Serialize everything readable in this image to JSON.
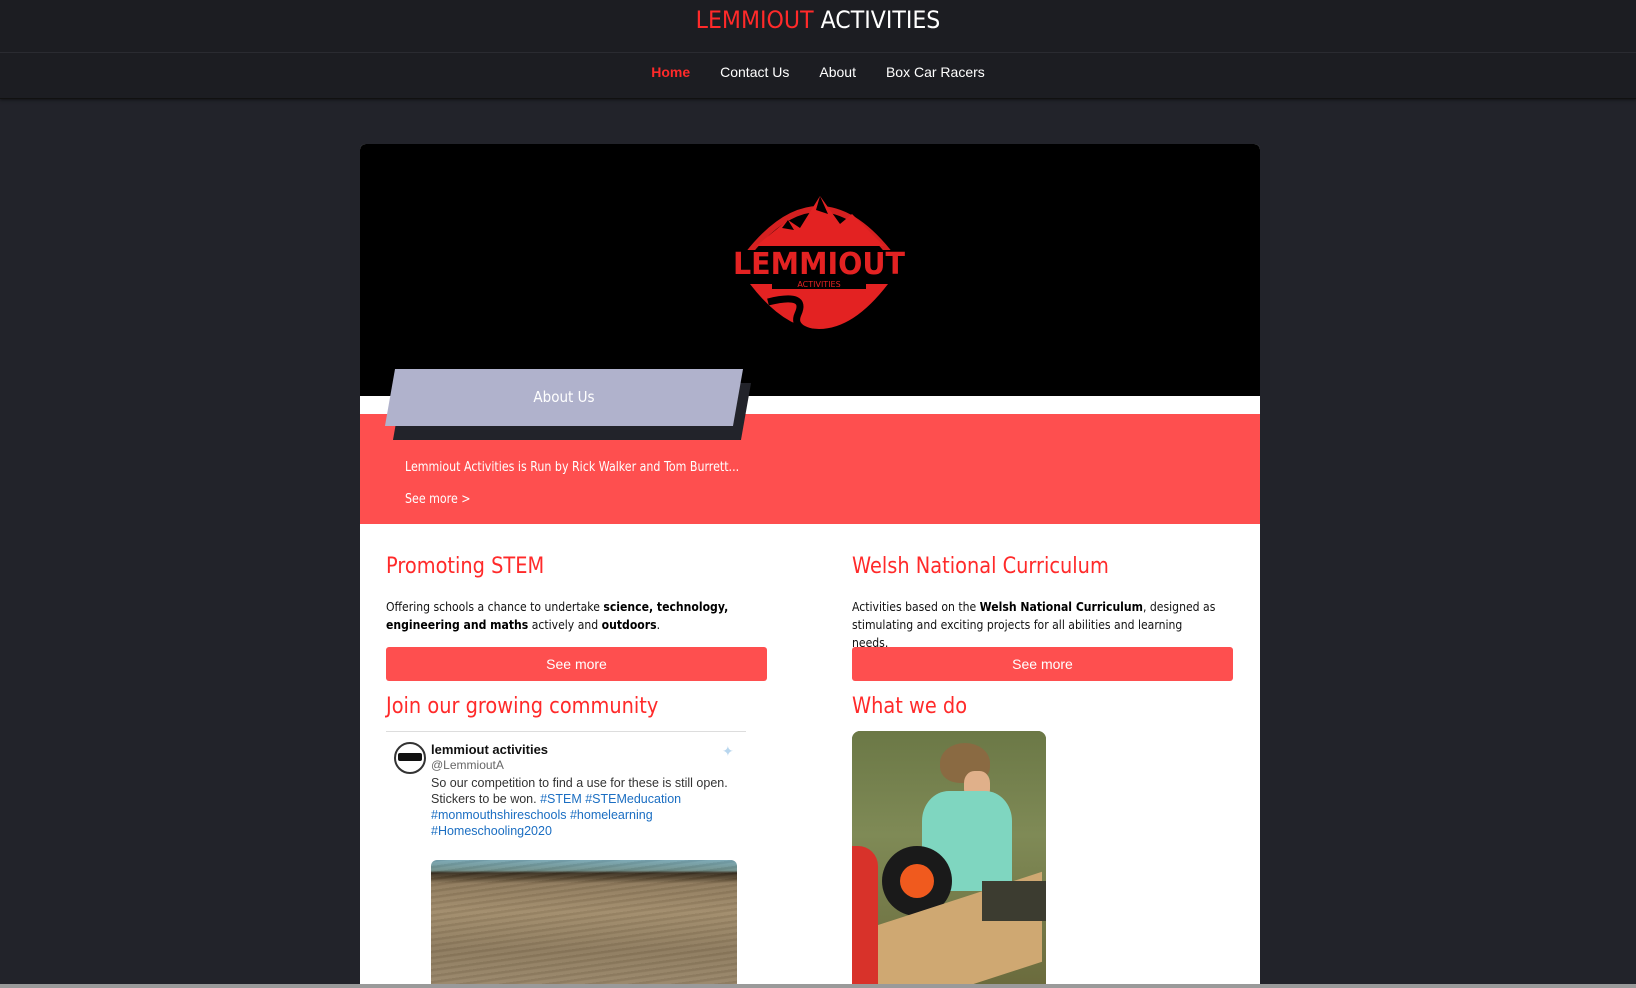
{
  "brand": {
    "part1": "LEMMIOUT",
    "part2": " ACTIVITIES"
  },
  "nav": [
    "Home",
    "Contact Us",
    "About",
    "Box Car Racers"
  ],
  "about": {
    "title": "About Us",
    "text": "Lemmiout Activities is Run by Rick Walker and Tom Burrett...",
    "more": "See more >"
  },
  "stem": {
    "title": "Promoting STEM",
    "p1": "Offering schools a chance to undertake ",
    "b1": "science, technology, engineering and maths",
    "p2": " actively and ",
    "b2": "outdoors",
    "p3": ".",
    "button": "See more"
  },
  "welsh": {
    "title": "Welsh National Curriculum",
    "p1": "Activities based on the ",
    "b1": "Welsh National Curriculum",
    "p2": ", designed as stimulating and exciting projects for all abilities and learning needs.",
    "button": "See more"
  },
  "community": {
    "title": "Join our growing community",
    "tweet": {
      "name": "lemmiout activities",
      "handle": "@LemmioutA",
      "text": "So our competition to find a use for these is still open. Stickers to be won.  ",
      "tags": "#STEM #STEMeducation #monmouthshireschools #homelearning #Homeschooling2020"
    }
  },
  "whatwedo": {
    "title": "What we do"
  },
  "colors": {
    "accent": "#fe4f4f",
    "brand_red": "#ff2a2a",
    "background": "#22232a"
  }
}
